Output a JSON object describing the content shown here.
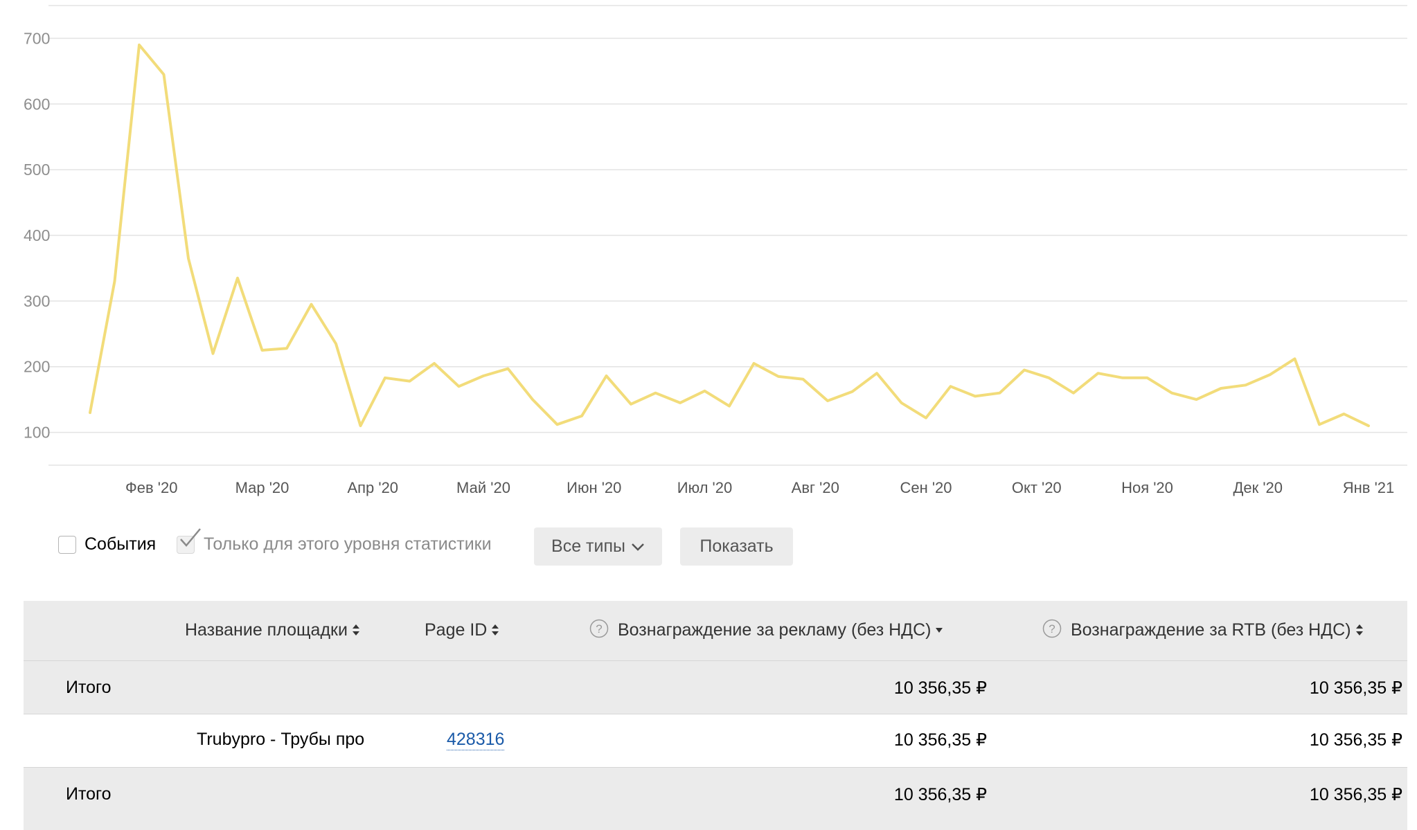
{
  "chart_data": {
    "type": "line",
    "y_ticks": [
      "100",
      "200",
      "300",
      "400",
      "500",
      "600",
      "700"
    ],
    "ylim": [
      50,
      750
    ],
    "x_ticks": [
      "Фев '20",
      "Мар '20",
      "Апр '20",
      "Май '20",
      "Июн '20",
      "Июл '20",
      "Авг '20",
      "Сен '20",
      "Окт '20",
      "Ноя '20",
      "Дек '20",
      "Янв '21"
    ],
    "x_tick_index": [
      2.5,
      7.0,
      11.5,
      16.0,
      20.5,
      25.0,
      29.5,
      34.0,
      38.5,
      43.0,
      47.5,
      52.0
    ],
    "color": "#f2dc7a",
    "series": [
      {
        "values": [
          130,
          330,
          690,
          645,
          365,
          220,
          335,
          225,
          228,
          295,
          235,
          110,
          183,
          178,
          205,
          170,
          186,
          197,
          150,
          112,
          125,
          186,
          143,
          160,
          145,
          163,
          140,
          205,
          185,
          181,
          148,
          162,
          190,
          145,
          122,
          170,
          155,
          160,
          195,
          183,
          160,
          190,
          183,
          183,
          160,
          150,
          167,
          172,
          188,
          212,
          112,
          128,
          110
        ]
      }
    ]
  },
  "controls": {
    "events_label": "События",
    "level_only_label": "Только для этого уровня статистики",
    "types_button": "Все типы",
    "show_button": "Показать"
  },
  "table": {
    "headers": {
      "site_name": "Название площадки",
      "page_id": "Page ID",
      "ad_reward": "Вознаграждение за рекламу (без НДС)",
      "rtb_reward": "Вознаграждение за RTB (без НДС)"
    },
    "total_top": {
      "label": "Итого",
      "ad_reward": "10 356,35 ₽",
      "rtb_reward": "10 356,35 ₽"
    },
    "row": {
      "site_name": "Trubypro - Трубы про",
      "page_id": "428316",
      "ad_reward": "10 356,35 ₽",
      "rtb_reward": "10 356,35 ₽"
    },
    "total_bottom": {
      "label": "Итого",
      "ad_reward": "10 356,35 ₽",
      "rtb_reward": "10 356,35 ₽"
    }
  }
}
